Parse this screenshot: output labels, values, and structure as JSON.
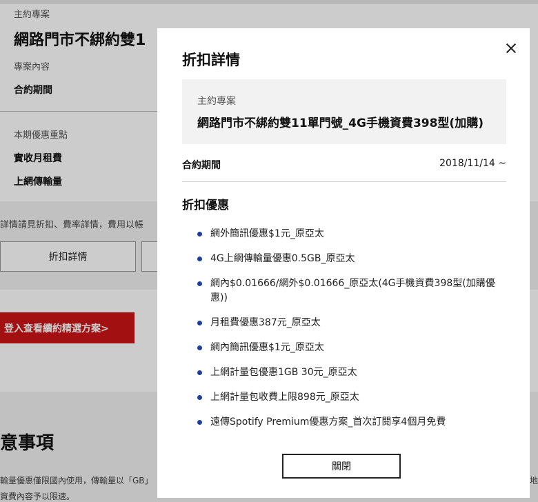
{
  "background": {
    "plan_label": "主約專案",
    "plan_title": "網路門市不綁約雙1",
    "content_label": "專案內容",
    "contract_period_label": "合約期間",
    "promo_label": "本期優惠重點",
    "monthly_fee_label": "實收月租費",
    "data_label": "上網傳輸量",
    "note": "詳情請見折扣、費率詳情，費用以帳",
    "discount_detail_button": "折扣詳情",
    "login_button": "登入查看續約精選方案>",
    "notice_heading": "意事項",
    "notice_line1": "輸量優惠僅限國內使用，傳輸量以「GB」",
    "notice_line1_right": "地",
    "notice_line2": "資費內容予以限速。"
  },
  "modal": {
    "title": "折扣詳情",
    "close_icon": "close-icon",
    "plan_label": "主約專案",
    "plan_name": "網路門市不綁約雙11單門號_4G手機資費398型(加購)",
    "contract_period_label": "合約期間",
    "contract_period_value": "2018/11/14 ~",
    "discount_title": "折扣優惠",
    "discounts": [
      "網外簡訊優惠$1元_原亞太",
      "4G上網傳輸量優惠0.5GB_原亞太",
      "網內$0.01666/網外$0.01666_原亞太(4G手機資費398型(加購優惠))",
      "月租費優惠387元_原亞太",
      "網內簡訊優惠$1元_原亞太",
      "上網計量包優惠1GB 30元_原亞太",
      "上網計量包收費上限898元_原亞太",
      "遠傳Spotify Premium優惠方案_首次訂閱享4個月免費"
    ],
    "close_button": "關閉",
    "bullet_color": "#1f3f99"
  },
  "colors": {
    "brand_red": "#cc1417",
    "overlay": "rgba(0,0,0,0.2)"
  }
}
